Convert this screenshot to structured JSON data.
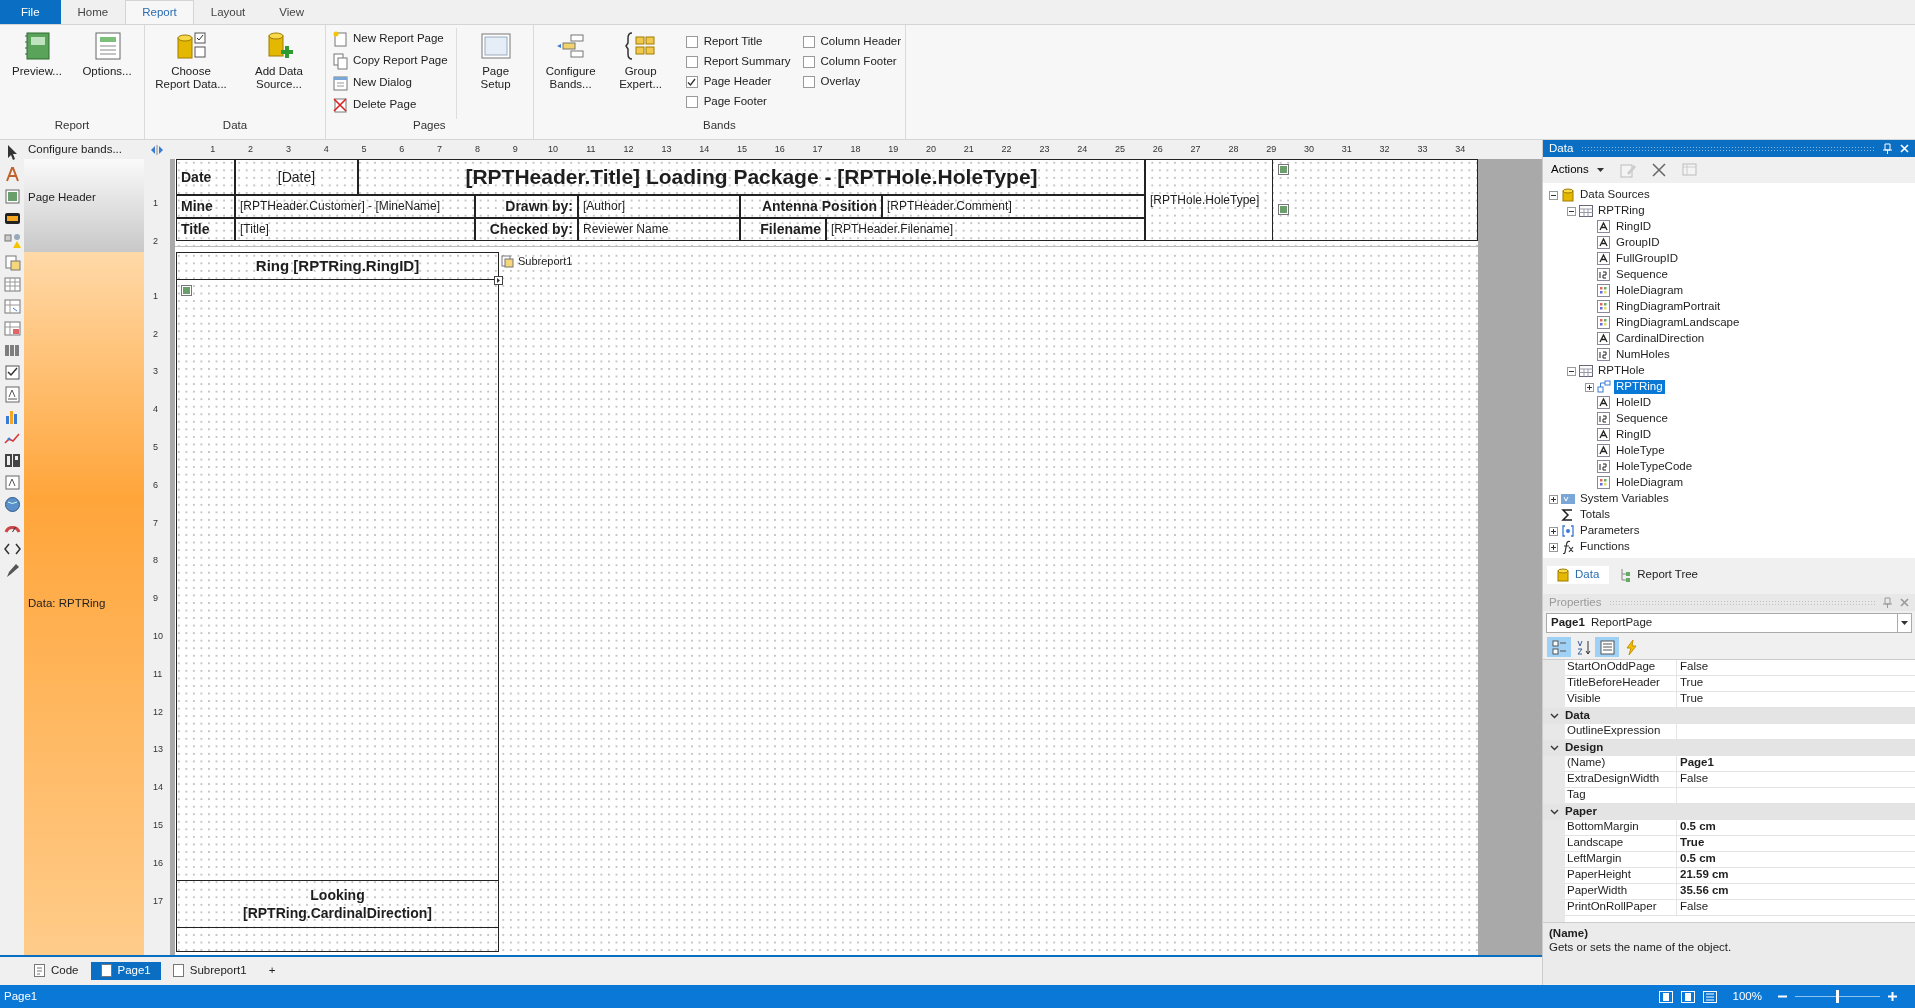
{
  "menu_tabs": [
    {
      "label": "File",
      "kind": "file",
      "selected": false
    },
    {
      "label": "Home",
      "kind": "tab",
      "selected": false
    },
    {
      "label": "Report",
      "kind": "tab",
      "selected": true
    },
    {
      "label": "Layout",
      "kind": "tab",
      "selected": false
    },
    {
      "label": "View",
      "kind": "tab",
      "selected": false
    }
  ],
  "ribbon_groups": [
    {
      "title": "Report",
      "items": [
        {
          "kind": "large",
          "label": "Preview..."
        },
        {
          "kind": "large",
          "label": "Options..."
        }
      ]
    },
    {
      "title": "Data",
      "items": [
        {
          "kind": "large",
          "label": "Choose Report Data..."
        },
        {
          "kind": "large",
          "label": "Add Data Source..."
        }
      ]
    },
    {
      "title": "Pages",
      "items": [
        {
          "kind": "small",
          "label": "New Report Page"
        },
        {
          "kind": "small",
          "label": "Copy Report Page"
        },
        {
          "kind": "small",
          "label": "New Dialog"
        },
        {
          "kind": "small",
          "label": "Delete Page"
        },
        {
          "kind": "large",
          "label": "Page Setup"
        }
      ]
    },
    {
      "title": "Bands",
      "items": [
        {
          "kind": "large",
          "label": "Configure Bands..."
        },
        {
          "kind": "large",
          "label": "Group Expert..."
        },
        {
          "kind": "check",
          "label": "Report Title",
          "checked": false
        },
        {
          "kind": "check",
          "label": "Report Summary",
          "checked": false
        },
        {
          "kind": "check",
          "label": "Page Header",
          "checked": true
        },
        {
          "kind": "check",
          "label": "Page Footer",
          "checked": false
        },
        {
          "kind": "check",
          "label": "Column Header",
          "checked": false
        },
        {
          "kind": "check",
          "label": "Column Footer",
          "checked": false
        },
        {
          "kind": "check",
          "label": "Overlay",
          "checked": false
        }
      ]
    }
  ],
  "designer": {
    "configure_bands": "Configure bands...",
    "bands": [
      {
        "label": "Page Header",
        "kind": "header"
      },
      {
        "label": "Data: RPTRing",
        "kind": "data"
      }
    ],
    "ruler": {
      "horizontal": [
        "1",
        "2",
        "3",
        "4",
        "5",
        "6",
        "7",
        "8",
        "9",
        "10",
        "11",
        "12",
        "13",
        "14",
        "15",
        "16",
        "17",
        "18",
        "19",
        "20",
        "21",
        "22",
        "23",
        "24",
        "25",
        "26",
        "27",
        "28",
        "29",
        "30",
        "31",
        "32",
        "33",
        "34"
      ],
      "header_band": [
        "1",
        "2"
      ],
      "data_band": [
        "1",
        "2",
        "3",
        "4",
        "5",
        "6",
        "7",
        "8",
        "9",
        "10",
        "11",
        "12",
        "13",
        "14",
        "15",
        "16",
        "17"
      ]
    },
    "header_cells": [
      {
        "text": "Date",
        "kind": "label"
      },
      {
        "text": "[Date]",
        "kind": "value"
      },
      {
        "text": "[RPTHeader.Title] Loading Package - [RPTHole.HoleType]",
        "kind": "label"
      },
      {
        "text": "Mine",
        "kind": "label"
      },
      {
        "text": "[RPTHeader.Customer] - [MineName]",
        "kind": "value"
      },
      {
        "text": "Drawn by:",
        "kind": "label"
      },
      {
        "text": "[Author]",
        "kind": "value"
      },
      {
        "text": "Antenna Position",
        "kind": "label"
      },
      {
        "text": "[RPTHeader.Comment]",
        "kind": "value"
      },
      {
        "text": "Title",
        "kind": "label"
      },
      {
        "text": "[Title]",
        "kind": "value"
      },
      {
        "text": "Checked by:",
        "kind": "label"
      },
      {
        "text": "Reviewer Name",
        "kind": "value"
      },
      {
        "text": "Filename",
        "kind": "label"
      },
      {
        "text": "[RPTHeader.Filename]",
        "kind": "value"
      },
      {
        "text": "[RPTHole.HoleType]",
        "kind": "value"
      }
    ],
    "subreport_panel": {
      "heading": "Ring [RPTRing.RingID]",
      "footer": [
        "Looking",
        "[RPTRing.CardinalDirection]"
      ]
    },
    "subreport_label": "Subreport1"
  },
  "page_tabs": [
    {
      "label": "Code",
      "selected": false
    },
    {
      "label": "Page1",
      "selected": true
    },
    {
      "label": "Subreport1",
      "selected": false
    }
  ],
  "add_tab": "+",
  "data_panel": {
    "title": "Data",
    "active": true,
    "actions": "Actions",
    "tree": [
      {
        "label": "Data Sources",
        "kind": "datasource",
        "expanded": true,
        "selected": false,
        "children": [
          {
            "label": "RPTRing",
            "kind": "table",
            "expanded": true,
            "selected": false,
            "children": [
              {
                "label": "RingID",
                "kind": "text",
                "selected": false
              },
              {
                "label": "GroupID",
                "kind": "text",
                "selected": false
              },
              {
                "label": "FullGroupID",
                "kind": "text",
                "selected": false
              },
              {
                "label": "Sequence",
                "kind": "number",
                "selected": false
              },
              {
                "label": "HoleDiagram",
                "kind": "image",
                "selected": false
              },
              {
                "label": "RingDiagramPortrait",
                "kind": "image",
                "selected": false
              },
              {
                "label": "RingDiagramLandscape",
                "kind": "image",
                "selected": false
              },
              {
                "label": "CardinalDirection",
                "kind": "text",
                "selected": false
              },
              {
                "label": "NumHoles",
                "kind": "number",
                "selected": false
              }
            ]
          },
          {
            "label": "RPTHole",
            "kind": "table",
            "expanded": true,
            "selected": false,
            "children": [
              {
                "label": "RPTRing",
                "kind": "relation",
                "expanded": false,
                "selected": true
              },
              {
                "label": "HoleID",
                "kind": "text",
                "selected": false
              },
              {
                "label": "Sequence",
                "kind": "number",
                "selected": false
              },
              {
                "label": "RingID",
                "kind": "text",
                "selected": false
              },
              {
                "label": "HoleType",
                "kind": "text",
                "selected": false
              },
              {
                "label": "HoleTypeCode",
                "kind": "number",
                "selected": false
              },
              {
                "label": "HoleDiagram",
                "kind": "image",
                "selected": false
              }
            ]
          }
        ]
      },
      {
        "label": "System Variables",
        "kind": "variables",
        "expanded": false,
        "selected": false
      },
      {
        "label": "Totals",
        "kind": "totals",
        "selected": false
      },
      {
        "label": "Parameters",
        "kind": "parameters",
        "expanded": false,
        "selected": false
      },
      {
        "label": "Functions",
        "kind": "functions",
        "expanded": false,
        "selected": false
      }
    ],
    "tabs": [
      {
        "label": "Data",
        "selected": true
      },
      {
        "label": "Report Tree",
        "selected": false
      }
    ]
  },
  "properties_panel": {
    "title": "Properties",
    "active": false,
    "object_name": "Page1",
    "object_type": "ReportPage",
    "toolbar": [
      {
        "selected": true
      },
      {
        "selected": false
      },
      {
        "selected": true
      },
      {
        "selected": false
      }
    ],
    "rows": [
      {
        "kind": "prop",
        "name": "StartOnOddPage",
        "value": "False",
        "modified": false
      },
      {
        "kind": "prop",
        "name": "TitleBeforeHeader",
        "value": "True",
        "modified": false
      },
      {
        "kind": "prop",
        "name": "Visible",
        "value": "True",
        "modified": false
      },
      {
        "kind": "category",
        "name": "Data",
        "expanded": true
      },
      {
        "kind": "prop",
        "name": "OutlineExpression"
      },
      {
        "kind": "category",
        "name": "Design",
        "expanded": true
      },
      {
        "kind": "prop",
        "name": "(Name)",
        "value": "Page1",
        "modified": true
      },
      {
        "kind": "prop",
        "name": "ExtraDesignWidth",
        "value": "False",
        "modified": false
      },
      {
        "kind": "prop",
        "name": "Tag"
      },
      {
        "kind": "category",
        "name": "Paper",
        "expanded": true
      },
      {
        "kind": "prop",
        "name": "BottomMargin",
        "value": "0.5 cm",
        "modified": true
      },
      {
        "kind": "prop",
        "name": "Landscape",
        "value": "True",
        "modified": true
      },
      {
        "kind": "prop",
        "name": "LeftMargin",
        "value": "0.5 cm",
        "modified": true
      },
      {
        "kind": "prop",
        "name": "PaperHeight",
        "value": "21.59 cm",
        "modified": true
      },
      {
        "kind": "prop",
        "name": "PaperWidth",
        "value": "35.56 cm",
        "modified": true
      },
      {
        "kind": "prop",
        "name": "PrintOnRollPaper",
        "value": "False",
        "modified": false
      }
    ],
    "description_title": "(Name)",
    "description": "Gets or sets the name of the object."
  },
  "status_bar": {
    "text": "Page1",
    "zoom": "100%",
    "zoom_slider": {
      "level": 0.5
    }
  }
}
